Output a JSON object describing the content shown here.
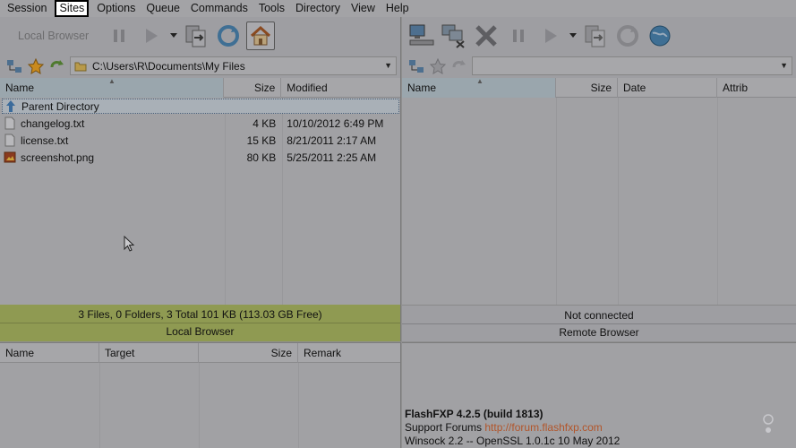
{
  "menu": [
    "Session",
    "Sites",
    "Options",
    "Queue",
    "Commands",
    "Tools",
    "Directory",
    "View",
    "Help"
  ],
  "toolbar_left": {
    "local_browser_label": "Local Browser"
  },
  "local": {
    "path": "C:\\Users\\R\\Documents\\My Files",
    "columns": [
      "Name",
      "Size",
      "Modified"
    ],
    "rows": [
      {
        "name": "Parent Directory",
        "size": "",
        "modified": "",
        "icon": "up-arrow-icon"
      },
      {
        "name": "changelog.txt",
        "size": "4 KB",
        "modified": "10/10/2012 6:49 PM",
        "icon": "text-file-icon"
      },
      {
        "name": "license.txt",
        "size": "15 KB",
        "modified": "8/21/2011 2:17 AM",
        "icon": "text-file-icon"
      },
      {
        "name": "screenshot.png",
        "size": "80 KB",
        "modified": "5/25/2011 2:25 AM",
        "icon": "image-file-icon"
      }
    ],
    "status_line1": "3 Files, 0 Folders, 3 Total 101 KB (113.03 GB Free)",
    "status_line2": "Local Browser"
  },
  "remote": {
    "path": "",
    "columns": [
      "Name",
      "Size",
      "Date",
      "Attrib"
    ],
    "status_line1": "Not connected",
    "status_line2": "Remote Browser"
  },
  "queue": {
    "columns": [
      "Name",
      "Target",
      "Size",
      "Remark"
    ]
  },
  "log": {
    "line1": "FlashFXP 4.2.5 (build 1813)",
    "line2_prefix": "Support Forums ",
    "line2_link": "http://forum.flashfxp.com",
    "line3": "Winsock 2.2 -- OpenSSL 1.0.1c 10 May 2012"
  },
  "colors": {
    "local_status_bg": "#8f9a52",
    "log_link": "#b2552a",
    "sorted_header": "#9aa6ad"
  }
}
